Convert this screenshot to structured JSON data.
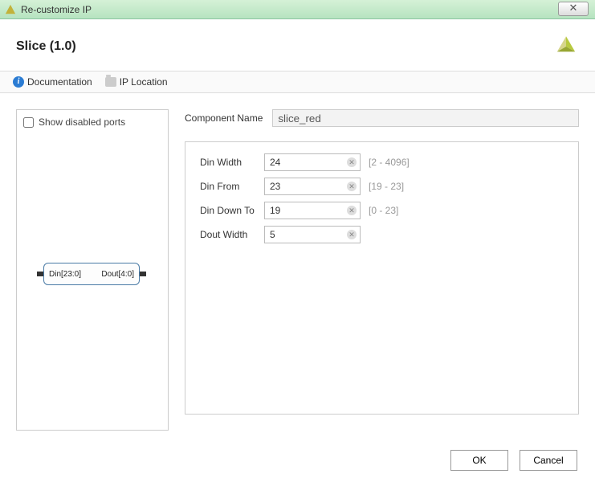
{
  "window": {
    "title": "Re-customize IP"
  },
  "header": {
    "title": "Slice (1.0)"
  },
  "toolbar": {
    "documentation_label": "Documentation",
    "ip_location_label": "IP Location"
  },
  "preview": {
    "show_disabled_label": "Show disabled ports",
    "din_label": "Din[23:0]",
    "dout_label": "Dout[4:0]"
  },
  "component": {
    "name_label": "Component Name",
    "name_value": "slice_red"
  },
  "params": [
    {
      "label": "Din Width",
      "value": "24",
      "range": "[2 - 4096]"
    },
    {
      "label": "Din From",
      "value": "23",
      "range": "[19 - 23]"
    },
    {
      "label": "Din Down To",
      "value": "19",
      "range": "[0 - 23]"
    },
    {
      "label": "Dout Width",
      "value": "5",
      "range": ""
    }
  ],
  "footer": {
    "ok_label": "OK",
    "cancel_label": "Cancel"
  }
}
